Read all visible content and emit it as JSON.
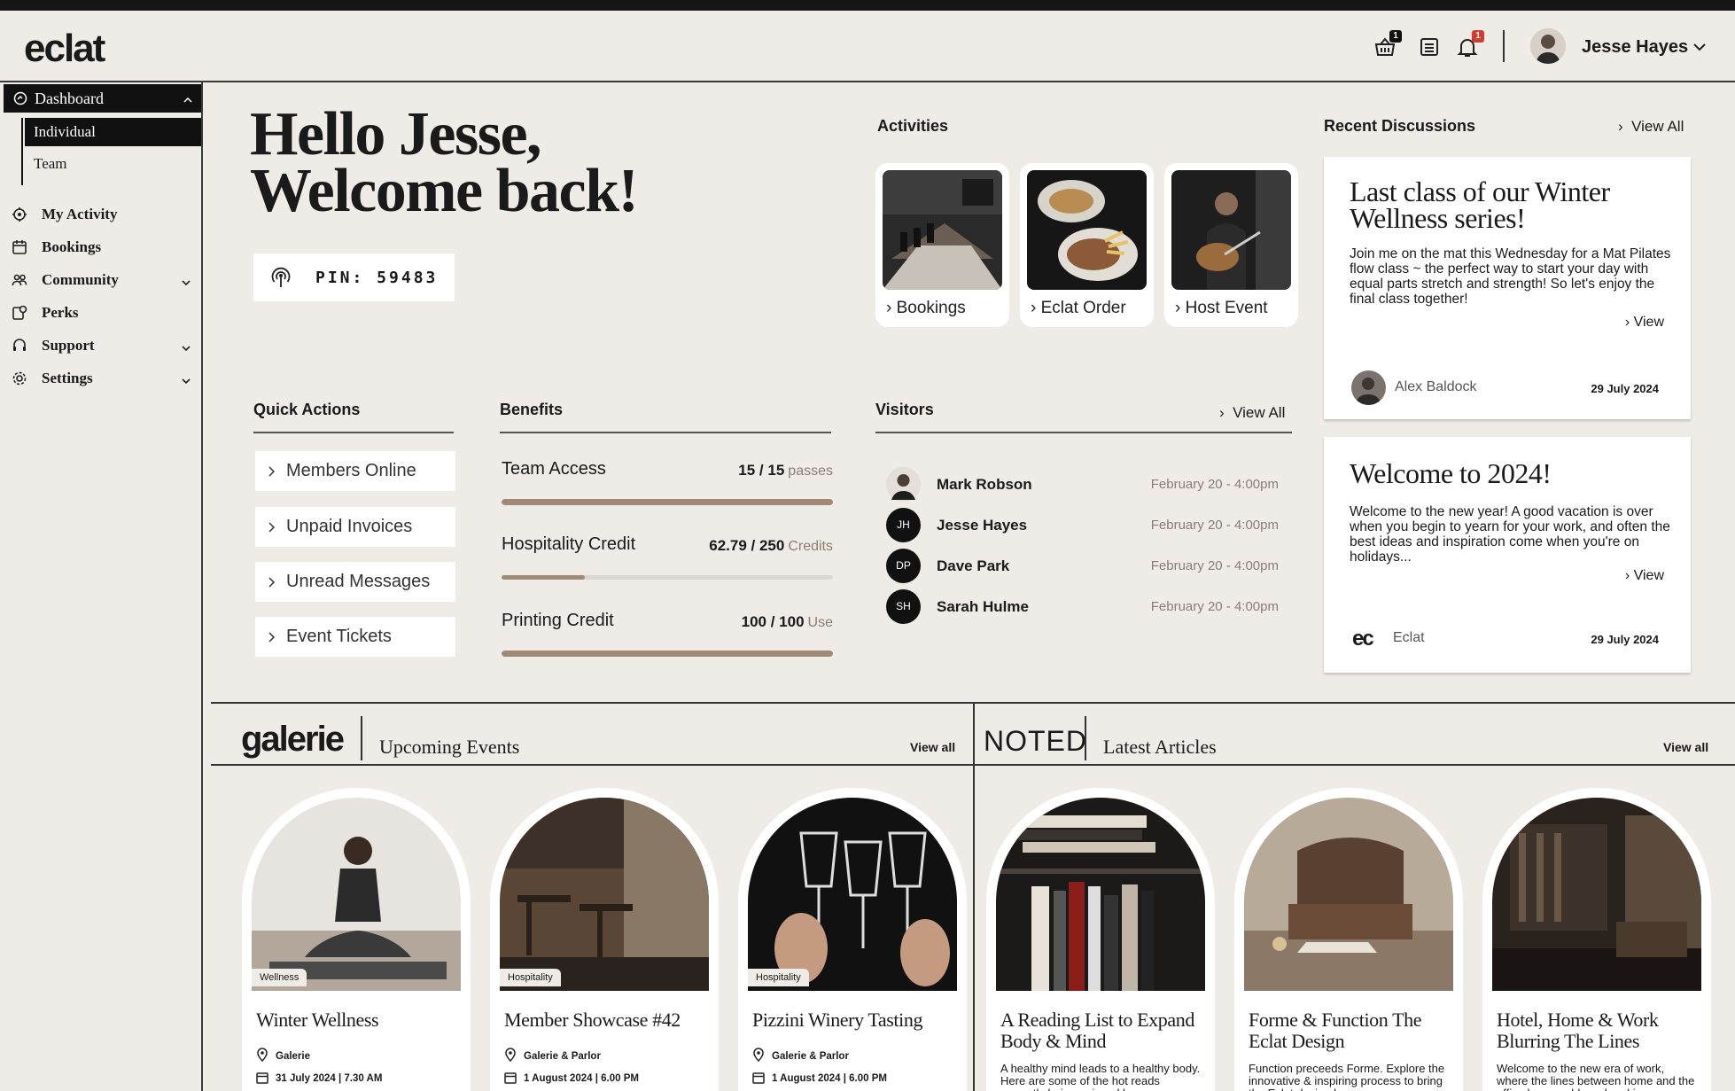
{
  "header": {
    "logo": "eclat",
    "cart_badge": "1",
    "notif_badge": "1",
    "user_name": "Jesse Hayes"
  },
  "sidebar": {
    "dashboard": "Dashboard",
    "sub_items": [
      "Individual",
      "Team"
    ],
    "items": [
      {
        "label": "My Activity",
        "icon": "activity-icon"
      },
      {
        "label": "Bookings",
        "icon": "calendar-icon"
      },
      {
        "label": "Community",
        "icon": "people-icon"
      },
      {
        "label": "Perks",
        "icon": "perks-icon"
      },
      {
        "label": "Support",
        "icon": "headset-icon"
      },
      {
        "label": "Settings",
        "icon": "gear-icon"
      }
    ]
  },
  "greeting": {
    "line1": "Hello Jesse,",
    "line2": "Welcome back!"
  },
  "pin": "PIN: 59483",
  "activities": {
    "title": "Activities",
    "cards": [
      "Bookings",
      "Eclat Order",
      "Host Event"
    ]
  },
  "discussions": {
    "title": "Recent Discussions",
    "view_all": "View All",
    "posts": [
      {
        "title": "Last class of our Winter Wellness series!",
        "body": "Join me on the mat this Wednesday for a Mat Pilates flow class ~ the perfect way to start your day with equal parts stretch and strength! So let's enjoy the final class together!",
        "view": "View",
        "author": "Alex Baldock",
        "date": "29 July 2024"
      },
      {
        "title": "Welcome to 2024!",
        "body": "Welcome to the new year! A good vacation is over when you begin to yearn for your work, and often the best ideas and inspiration come when you're on holidays...",
        "view": "View",
        "author": "Eclat",
        "date": "29 July 2024"
      }
    ]
  },
  "quick_actions": {
    "title": "Quick Actions",
    "items": [
      "Members Online",
      "Unpaid Invoices",
      "Unread Messages",
      "Event Tickets"
    ]
  },
  "benefits": {
    "title": "Benefits",
    "items": [
      {
        "name": "Team Access",
        "value": "15 / 15",
        "unit": "passes",
        "fraction": 1.0
      },
      {
        "name": "Hospitality Credit",
        "value": "62.79 / 250",
        "unit": "Credits",
        "fraction": 0.2512
      },
      {
        "name": "Printing Credit",
        "value": "100 / 100",
        "unit": "Use",
        "fraction": 1.0
      }
    ]
  },
  "visitors": {
    "title": "Visitors",
    "view_all": "View All",
    "rows": [
      {
        "initials": "",
        "name": "Mark Robson",
        "time": "February 20 - 4:00pm"
      },
      {
        "initials": "JH",
        "name": "Jesse Hayes",
        "time": "February 20 - 4:00pm"
      },
      {
        "initials": "DP",
        "name": "Dave Park",
        "time": "February 20 - 4:00pm"
      },
      {
        "initials": "SH",
        "name": "Sarah Hulme",
        "time": "February 20 - 4:00pm"
      }
    ]
  },
  "events": {
    "brand": "galerie",
    "title": "Upcoming Events",
    "view_all": "View all",
    "cards": [
      {
        "tag": "Wellness",
        "title": "Winter Wellness",
        "location": "Galerie",
        "datetime": "31 July 2024 | 7.30 AM"
      },
      {
        "tag": "Hospitality",
        "title": "Member Showcase #42",
        "location": "Galerie & Parlor",
        "datetime": "1 August 2024 | 6.00 PM"
      },
      {
        "tag": "Hospitality",
        "title": "Pizzini Winery Tasting",
        "location": "Galerie & Parlor",
        "datetime": "1 August 2024 | 6.00 PM"
      }
    ]
  },
  "articles": {
    "brand": "NOTED",
    "title": "Latest Articles",
    "view_all": "View all",
    "cards": [
      {
        "title": "A Reading List to Expand Body & Mind",
        "excerpt": "A healthy mind leads to a healthy body. Here are some of the hot reads currently being enjoyed by"
      },
      {
        "title": "Forme & Function The Eclat Design",
        "excerpt": "Function preceeds Forme. Explore the innovative & inspiring process to bring the Eclat design language"
      },
      {
        "title": "Hotel, Home & Work Blurring The Lines",
        "excerpt": "Welcome to the new era of work, where the lines between home and the office become blurred and in-"
      }
    ]
  }
}
